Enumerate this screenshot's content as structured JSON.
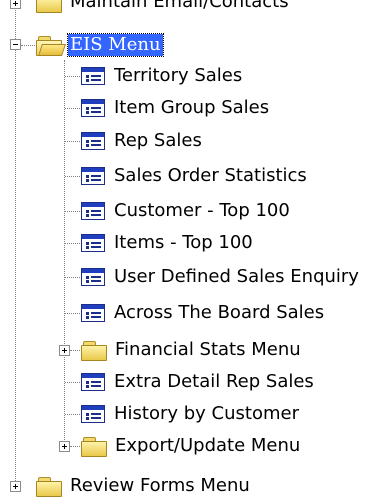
{
  "tree": {
    "top_partial": "Maintain Email/Contacts",
    "eis_menu": "EIS Menu",
    "children": [
      {
        "label": "Territory Sales",
        "type": "report"
      },
      {
        "label": "Item Group Sales",
        "type": "report"
      },
      {
        "label": "Rep Sales",
        "type": "report"
      },
      {
        "label": "Sales Order Statistics",
        "type": "report"
      },
      {
        "label": "Customer - Top 100",
        "type": "report"
      },
      {
        "label": "Items - Top 100",
        "type": "report"
      },
      {
        "label": "User Defined Sales Enquiry",
        "type": "report"
      },
      {
        "label": "Across The Board Sales",
        "type": "report"
      },
      {
        "label": "Financial Stats Menu",
        "type": "folder"
      },
      {
        "label": "Extra Detail Rep Sales",
        "type": "report"
      },
      {
        "label": "History by Customer",
        "type": "report"
      },
      {
        "label": "Export/Update Menu",
        "type": "folder"
      }
    ],
    "bottom_partial": "Review Forms Menu"
  },
  "colors": {
    "selection": "#3366ff",
    "icon_blue": "#1f3fbf",
    "folder_yellow": "#f0d25c"
  },
  "icons": {
    "folder": "folder-icon",
    "open_folder": "open-folder-icon",
    "report": "report-form-icon"
  }
}
